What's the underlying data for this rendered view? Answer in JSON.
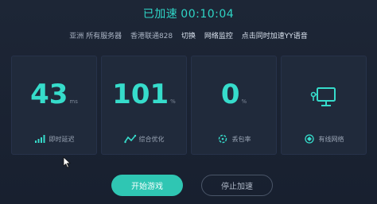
{
  "header": {
    "status_label": "已加速",
    "timer": "00:10:04"
  },
  "info": {
    "region": "亚洲 所有服务器",
    "server": "香港联通828",
    "switch_link": "切换",
    "monitor_link": "网络监控",
    "yy_link": "点击同时加速YY语音"
  },
  "cards": [
    {
      "value": "43",
      "unit": "ms",
      "label": "即时延迟",
      "icon": "signal-bars-icon"
    },
    {
      "value": "101",
      "unit": "%",
      "label": "综合优化",
      "icon": "wave-icon"
    },
    {
      "value": "0",
      "unit": "%",
      "label": "丢包率",
      "icon": "packet-loss-icon"
    },
    {
      "value": "",
      "unit": "",
      "label": "有线网络",
      "icon": "wired-network-icon"
    }
  ],
  "buttons": {
    "start": "开始游戏",
    "stop": "停止加速"
  },
  "colors": {
    "accent": "#36dccb",
    "background": "#1b2333",
    "card": "#202a3b"
  }
}
